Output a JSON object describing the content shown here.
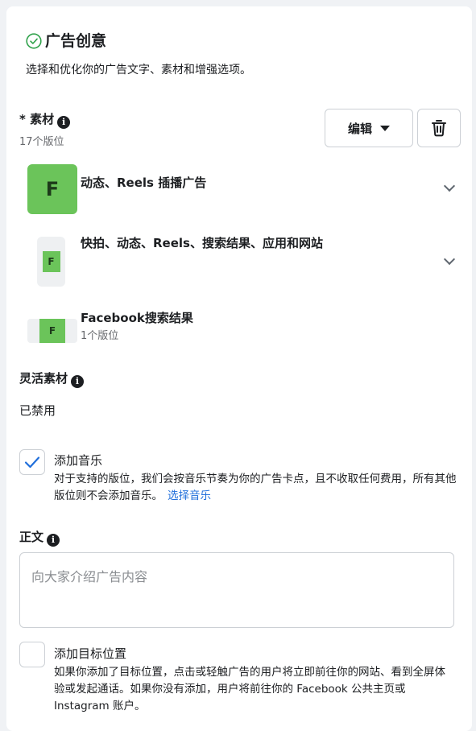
{
  "section": {
    "title": "广告创意",
    "subtitle": "选择和优化你的广告文字、素材和增强选项。"
  },
  "creative": {
    "label": "* 素材",
    "placements_count": "17个版位",
    "edit_label": "编辑",
    "items": [
      {
        "title": "动态、Reels 插播广告",
        "thumb_letter": "F"
      },
      {
        "title": "快拍、动态、Reels、搜索结果、应用和网站",
        "thumb_letter": "F"
      },
      {
        "title": "Facebook搜索结果",
        "sub": "1个版位",
        "thumb_letter": "F"
      }
    ]
  },
  "flexible": {
    "label": "灵活素材",
    "status": "已禁用"
  },
  "music": {
    "label": "添加音乐",
    "checked": true,
    "desc": "对于支持的版位，我们会按音乐节奏为你的广告卡点，且不收取任何费用，所有其他版位则不会添加音乐。",
    "link": "选择音乐"
  },
  "body_text": {
    "label": "正文",
    "placeholder": "向大家介绍广告内容"
  },
  "destination": {
    "label": "添加目标位置",
    "checked": false,
    "desc": "如果你添加了目标位置，点击或轻触广告的用户将立即前往你的网站、看到全屏体验或发起通话。如果你没有添加，用户将前往你的 Facebook 公共主页或 Instagram 账户。"
  },
  "colors": {
    "accent": "#216fdb",
    "thumb_green": "#6bc45a",
    "check_green": "#31a24c"
  }
}
